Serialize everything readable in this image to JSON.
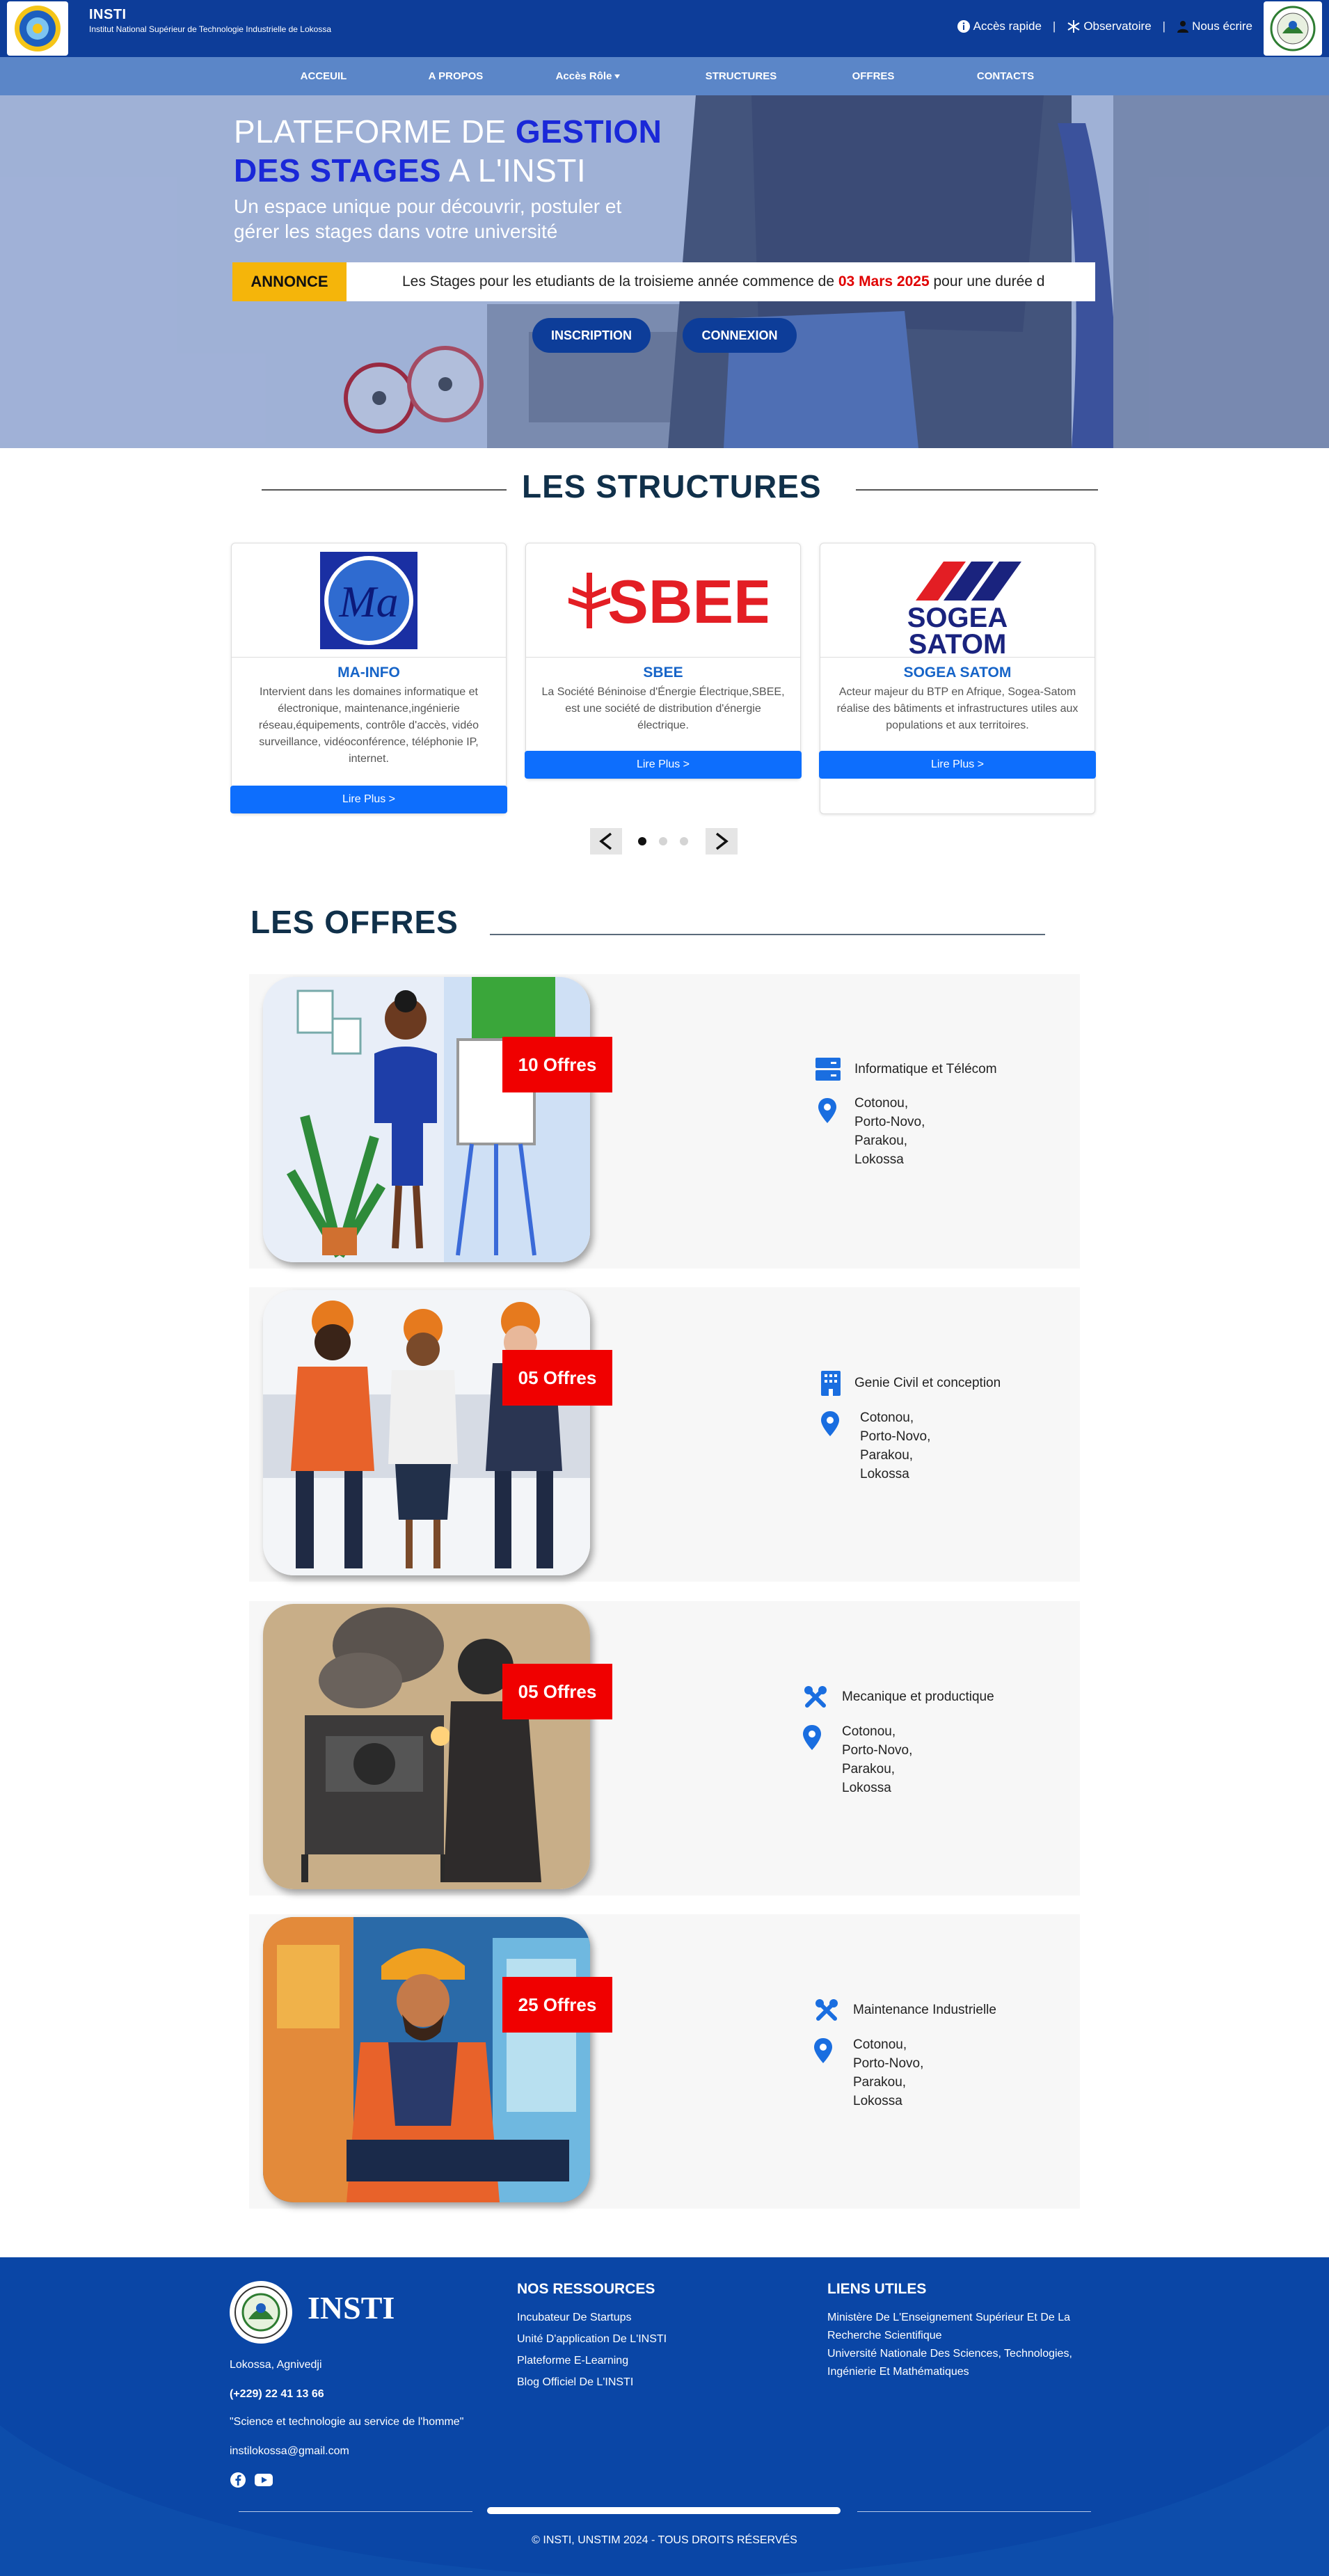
{
  "topbar": {
    "brand_name": "INSTI",
    "brand_sub": "Institut National Supérieur de Technologie Industrielle de Lokossa",
    "quick_access": "Accès rapide",
    "observatory": "Observatoire",
    "write_us": "Nous écrire",
    "separator": "|"
  },
  "nav": {
    "items": [
      "ACCEUIL",
      "A PROPOS",
      "Accès Rôle",
      "STRUCTURES",
      "OFFRES",
      "CONTACTS"
    ]
  },
  "hero": {
    "title_part1": "PLATEFORME DE ",
    "title_hl1": "GESTION",
    "title_hl2": "DES STAGES",
    "title_part2": " A L'INSTI",
    "subtitle": "Un espace unique pour découvrir, postuler et gérer les stages dans votre université",
    "annonce_label": "ANNONCE",
    "annonce_text_a": "Les Stages pour les etudiants de la troisieme année commence de ",
    "annonce_date": "03 Mars 2025",
    "annonce_text_b": " pour une durée d",
    "btn_inscription": "INSCRIPTION",
    "btn_connexion": "CONNEXION"
  },
  "structures": {
    "title": "LES STRUCTURES",
    "cards": [
      {
        "name": "MA-INFO",
        "logo_text": "Ma",
        "desc": "Intervient dans les domaines informatique et électronique, maintenance,ingénierie réseau,équipements, contrôle d'accès, vidéo surveillance, vidéoconférence, téléphonie IP, internet.",
        "button": "Lire Plus >"
      },
      {
        "name": "SBEE",
        "logo_text": "SBEE",
        "desc": "La Société Béninoise d'Énergie Électrique,SBEE, est une société de distribution d'énergie électrique.",
        "button": "Lire Plus >"
      },
      {
        "name": "SOGEA SATOM",
        "logo_text_1": "SOGEA",
        "logo_text_2": "SATOM",
        "desc": "Acteur majeur du BTP en Afrique, Sogea-Satom réalise des bâtiments et infrastructures utiles aux populations et aux territoires.",
        "button": "Lire Plus >"
      }
    ],
    "prev": "<",
    "next": ">"
  },
  "offers": {
    "title": "LES OFFRES",
    "items": [
      {
        "badge": "10 Offres",
        "domain": "Informatique et Télécom",
        "icon": "server-icon",
        "cities": [
          "Cotonou,",
          "Porto-Novo,",
          "Parakou,",
          "Lokossa"
        ]
      },
      {
        "badge": "05 Offres",
        "domain": "Genie Civil et conception",
        "icon": "building-icon",
        "cities": [
          "Cotonou,",
          "Porto-Novo,",
          "Parakou,",
          "Lokossa"
        ]
      },
      {
        "badge": "05 Offres",
        "domain": "Mecanique et productique",
        "icon": "tools-icon",
        "cities": [
          "Cotonou,",
          "Porto-Novo,",
          "Parakou,",
          "Lokossa"
        ]
      },
      {
        "badge": "25 Offres",
        "domain": "Maintenance Industrielle",
        "icon": "tools-icon",
        "cities": [
          "Cotonou,",
          "Porto-Novo,",
          "Parakou,",
          "Lokossa"
        ]
      }
    ]
  },
  "footer": {
    "brand": "INSTI",
    "address": "Lokossa, Agnivedji",
    "phone": "(+229) 22 41 13 66",
    "motto": "\"Science et technologie au service de l'homme\"",
    "email": "instilokossa@gmail.com",
    "resources_title": "NOS RESSOURCES",
    "resources": [
      "Incubateur De Startups",
      "Unité D'application De L'INSTI",
      "Plateforme E-Learning",
      "Blog Officiel De L'INSTI"
    ],
    "links_title": "LIENS UTILES",
    "links": [
      "Ministère De L'Enseignement Supérieur Et De La Recherche Scientifique",
      "Université Nationale Des Sciences, Technologies, Ingénierie Et Mathématiques"
    ],
    "copyright": "© INSTI, UNSTIM 2024 - TOUS DROITS RÉSERVÉS"
  },
  "colors": {
    "topbar": "#0d3d99",
    "nav": "#5b86c8",
    "accent_blue": "#0d6efd",
    "badge_red": "#f00000",
    "annonce_yellow": "#f5b50a",
    "footer": "#0d4dab"
  }
}
